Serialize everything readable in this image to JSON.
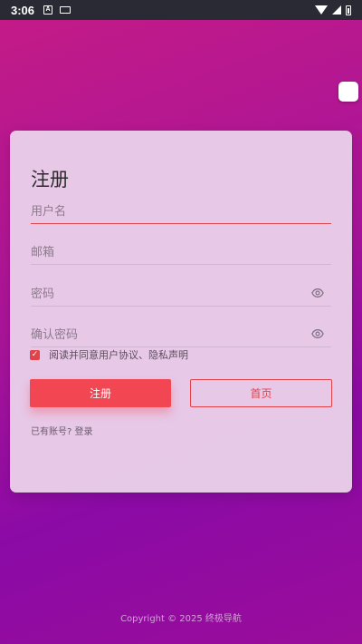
{
  "status_bar": {
    "time": "3:06",
    "left_icon_letter": "A"
  },
  "form": {
    "title": "注册",
    "username_label": "用户名",
    "email_label": "邮箱",
    "password_label": "密码",
    "confirm_password_label": "确认密码",
    "agree_checked": true,
    "agree_text": "阅读并同意用户协议、隐私声明",
    "register_button": "注册",
    "home_button": "首页",
    "login_link": "已有账号? 登录"
  },
  "footer": {
    "copyright": "Copyright © 2025 终极导航"
  },
  "colors": {
    "accent": "#e2424a",
    "primary_button": "#f24653"
  }
}
